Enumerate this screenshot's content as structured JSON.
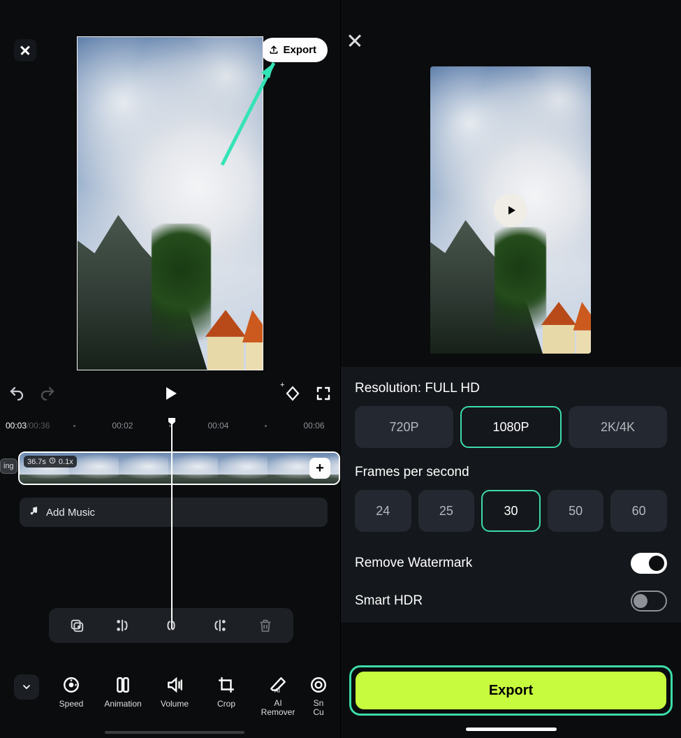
{
  "editor": {
    "export_pill": "Export",
    "playback": {
      "current_time": "00:03",
      "total_time": "/00:36"
    },
    "ruler": {
      "marks": [
        "00:02",
        "00:04",
        "00:06"
      ]
    },
    "clip": {
      "duration_badge": "36.7s",
      "speed_badge": "0.1x"
    },
    "ing_tag": "ing",
    "add_music_label": "Add Music",
    "nav": {
      "speed": "Speed",
      "animation": "Animation",
      "volume": "Volume",
      "crop": "Crop",
      "ai_remover": "AI\nRemover",
      "smart_cut": "Sn\nCu"
    }
  },
  "export": {
    "resolution_label": "Resolution: FULL HD",
    "res_options": [
      "720P",
      "1080P",
      "2K/4K"
    ],
    "fps_label": "Frames per second",
    "fps_options": [
      "24",
      "25",
      "30",
      "50",
      "60"
    ],
    "remove_watermark": "Remove Watermark",
    "smart_hdr": "Smart HDR",
    "export_button": "Export"
  }
}
